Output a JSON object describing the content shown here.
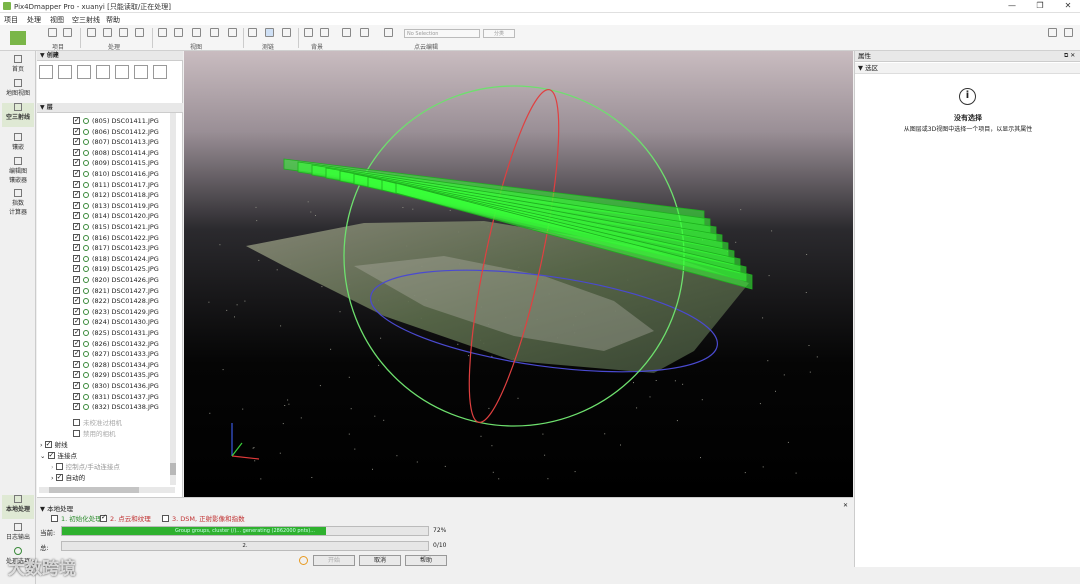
{
  "window": {
    "title": "Pix4Dmapper Pro - xuanyi [只能读取/正在处理]",
    "controls": [
      "—",
      "❐",
      "✕"
    ]
  },
  "menu": [
    "项目",
    "处理",
    "视图",
    "空三射线",
    "帮助"
  ],
  "toolbar": {
    "groups": [
      "项目",
      "处理",
      "视图",
      "测链",
      "背景",
      "点云编辑"
    ],
    "dropdown_value": "No Selection",
    "classify_label": "分类"
  },
  "leftnav": {
    "items": [
      "首页",
      "地图视图",
      "空三射线",
      "镶嵌",
      "编辑图\n镶嵌器",
      "指数\n计算器"
    ],
    "bottom_items": [
      "本地处理",
      "日志输出",
      "处理选项"
    ]
  },
  "tree": {
    "create_header": "创建",
    "layers_header": "层",
    "images": [
      "(805) DSC01411.JPG",
      "(806) DSC01412.JPG",
      "(807) DSC01413.JPG",
      "(808) DSC01414.JPG",
      "(809) DSC01415.JPG",
      "(810) DSC01416.JPG",
      "(811) DSC01417.JPG",
      "(812) DSC01418.JPG",
      "(813) DSC01419.JPG",
      "(814) DSC01420.JPG",
      "(815) DSC01421.JPG",
      "(816) DSC01422.JPG",
      "(817) DSC01423.JPG",
      "(818) DSC01424.JPG",
      "(819) DSC01425.JPG",
      "(820) DSC01426.JPG",
      "(821) DSC01427.JPG",
      "(822) DSC01428.JPG",
      "(823) DSC01429.JPG",
      "(824) DSC01430.JPG",
      "(825) DSC01431.JPG",
      "(826) DSC01432.JPG",
      "(827) DSC01433.JPG",
      "(828) DSC01434.JPG",
      "(829) DSC01435.JPG",
      "(830) DSC01436.JPG",
      "(831) DSC01437.JPG",
      "(832) DSC01438.JPG"
    ],
    "extra_items": [
      "未校准过相机",
      "禁用的相机"
    ],
    "groups": [
      "射线",
      "连接点",
      "控制点/手动连接点",
      "自动的"
    ]
  },
  "properties": {
    "header": "属性",
    "section": "选区",
    "no_selection_title": "没有选择",
    "no_selection_text": "从图层或3D视图中选择一个项目，以显示其属性"
  },
  "processing": {
    "header": "本地处理",
    "steps": [
      {
        "label": "1. 初始化处理",
        "checked": false,
        "color": "#2a8a2a"
      },
      {
        "label": "2. 点云和纹理",
        "checked": true,
        "color": "#c03030"
      },
      {
        "label": "3. DSM, 正射影像和指数",
        "checked": false,
        "color": "#c03030"
      }
    ],
    "current_label": "当前:",
    "current_text": "Group groups, cluster (/)... generating (2862000 pnts)...",
    "current_percent": "72%",
    "current_fraction": 0.72,
    "total_label": "总:",
    "total_center": "2.",
    "total_value": "0/10",
    "total_fraction": 0.0,
    "buttons": [
      "开始",
      "取消",
      "帮助"
    ]
  },
  "watermark": "大数跨境",
  "colors": {
    "accent_green": "#2fb12f",
    "sphere_green": "#6ee06e",
    "camera_green": "#39ff39"
  }
}
